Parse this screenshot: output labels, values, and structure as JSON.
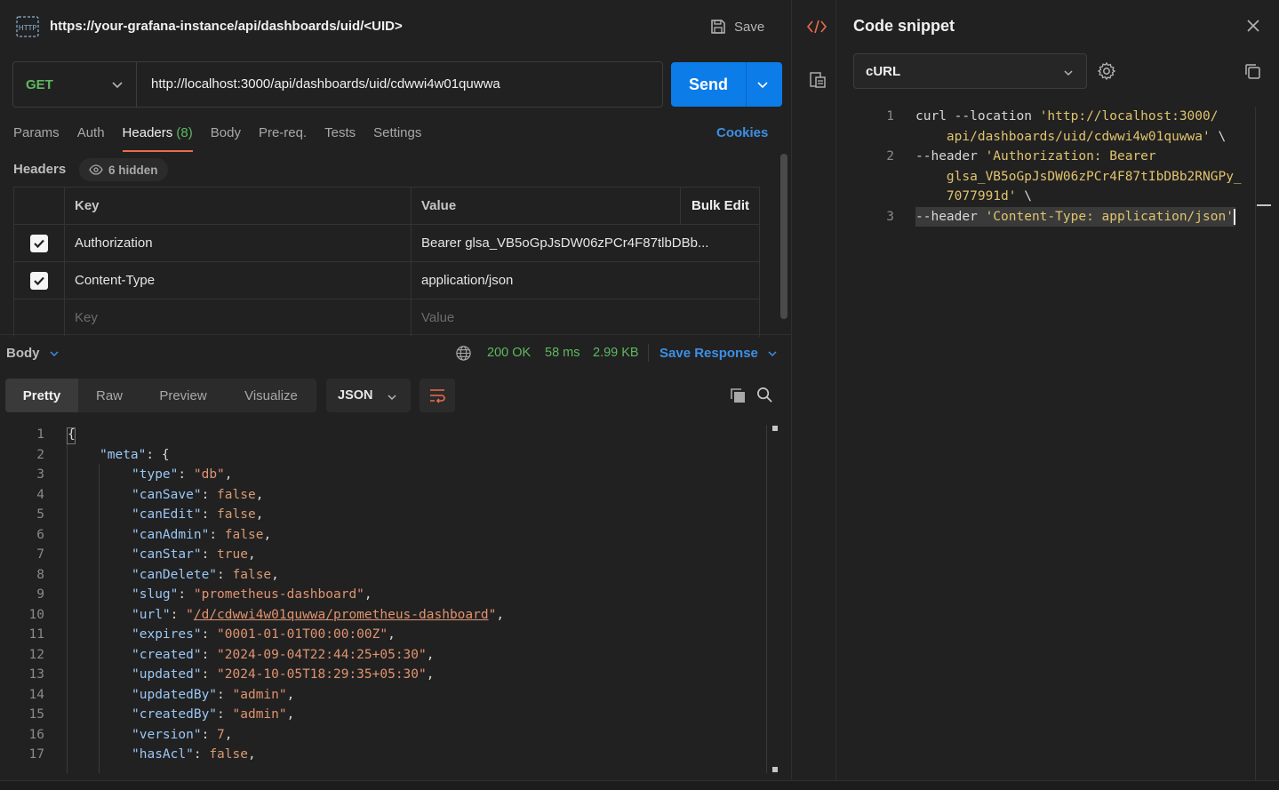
{
  "request": {
    "title": "https://your-grafana-instance/api/dashboards/uid/<UID>",
    "save_label": "Save",
    "method": "GET",
    "url": "http://localhost:3000/api/dashboards/uid/cdwwi4w01quwwa",
    "send_label": "Send"
  },
  "tabs": {
    "params": "Params",
    "auth": "Auth",
    "headers": "Headers",
    "headers_count": "(8)",
    "body": "Body",
    "prereq": "Pre-req.",
    "tests": "Tests",
    "settings": "Settings",
    "cookies": "Cookies"
  },
  "headers_section": {
    "label": "Headers",
    "hidden": "6 hidden",
    "col_key": "Key",
    "col_value": "Value",
    "bulk_edit": "Bulk Edit",
    "rows": [
      {
        "key": "Authorization",
        "value": "Bearer glsa_VB5oGpJsDW06zPCr4F87tlbDBb..."
      },
      {
        "key": "Content-Type",
        "value": "application/json"
      }
    ],
    "key_placeholder": "Key",
    "value_placeholder": "Value"
  },
  "response": {
    "body_label": "Body",
    "status": "200 OK",
    "time": "58 ms",
    "size": "2.99 KB",
    "save_response": "Save Response",
    "view_tabs": [
      "Pretty",
      "Raw",
      "Preview",
      "Visualize"
    ],
    "format": "JSON"
  },
  "response_code": {
    "lines": [
      {
        "n": "1",
        "t": "{"
      },
      {
        "n": "2",
        "k": "\"meta\"",
        "rest": ": {"
      },
      {
        "n": "3",
        "k": "\"type\"",
        "v": "\"db\"",
        "vt": "s"
      },
      {
        "n": "4",
        "k": "\"canSave\"",
        "v": "false",
        "vt": "b"
      },
      {
        "n": "5",
        "k": "\"canEdit\"",
        "v": "false",
        "vt": "b"
      },
      {
        "n": "6",
        "k": "\"canAdmin\"",
        "v": "false",
        "vt": "b"
      },
      {
        "n": "7",
        "k": "\"canStar\"",
        "v": "true",
        "vt": "b"
      },
      {
        "n": "8",
        "k": "\"canDelete\"",
        "v": "false",
        "vt": "b"
      },
      {
        "n": "9",
        "k": "\"slug\"",
        "v": "\"prometheus-dashboard\"",
        "vt": "s"
      },
      {
        "n": "10",
        "k": "\"url\"",
        "v": "\"/d/cdwwi4w01quwwa/prometheus-dashboard\"",
        "vt": "link"
      },
      {
        "n": "11",
        "k": "\"expires\"",
        "v": "\"0001-01-01T00:00:00Z\"",
        "vt": "s"
      },
      {
        "n": "12",
        "k": "\"created\"",
        "v": "\"2024-09-04T22:44:25+05:30\"",
        "vt": "s"
      },
      {
        "n": "13",
        "k": "\"updated\"",
        "v": "\"2024-10-05T18:29:35+05:30\"",
        "vt": "s"
      },
      {
        "n": "14",
        "k": "\"updatedBy\"",
        "v": "\"admin\"",
        "vt": "s"
      },
      {
        "n": "15",
        "k": "\"createdBy\"",
        "v": "\"admin\"",
        "vt": "s"
      },
      {
        "n": "16",
        "k": "\"version\"",
        "v": "7",
        "vt": "n"
      },
      {
        "n": "17",
        "k": "\"hasAcl\"",
        "v": "false",
        "vt": "b"
      }
    ]
  },
  "snippet": {
    "title": "Code snippet",
    "language": "cURL",
    "lines": [
      {
        "n": "1",
        "cmd": "curl --location ",
        "str": "'http://localhost:3000/"
      },
      {
        "n": "",
        "cmd": "    ",
        "str": "api/dashboards/uid/cdwwi4w01quwwa'",
        "tail": " \\"
      },
      {
        "n": "2",
        "cmd": "--header ",
        "str": "'Authorization: Bearer"
      },
      {
        "n": "",
        "cmd": "    ",
        "str": "glsa_VB5oGpJsDW06zPCr4F87tIbDBb2RNGPy_"
      },
      {
        "n": "",
        "cmd": "    ",
        "str": "7077991d'",
        "tail": " \\"
      },
      {
        "n": "3",
        "cmd": "--header ",
        "str": "'Content-Type: application/json'"
      }
    ]
  },
  "colors": {
    "accent_blue": "#0c7ce8",
    "method_green": "#5fb760",
    "active_tab": "#e96c4c"
  }
}
